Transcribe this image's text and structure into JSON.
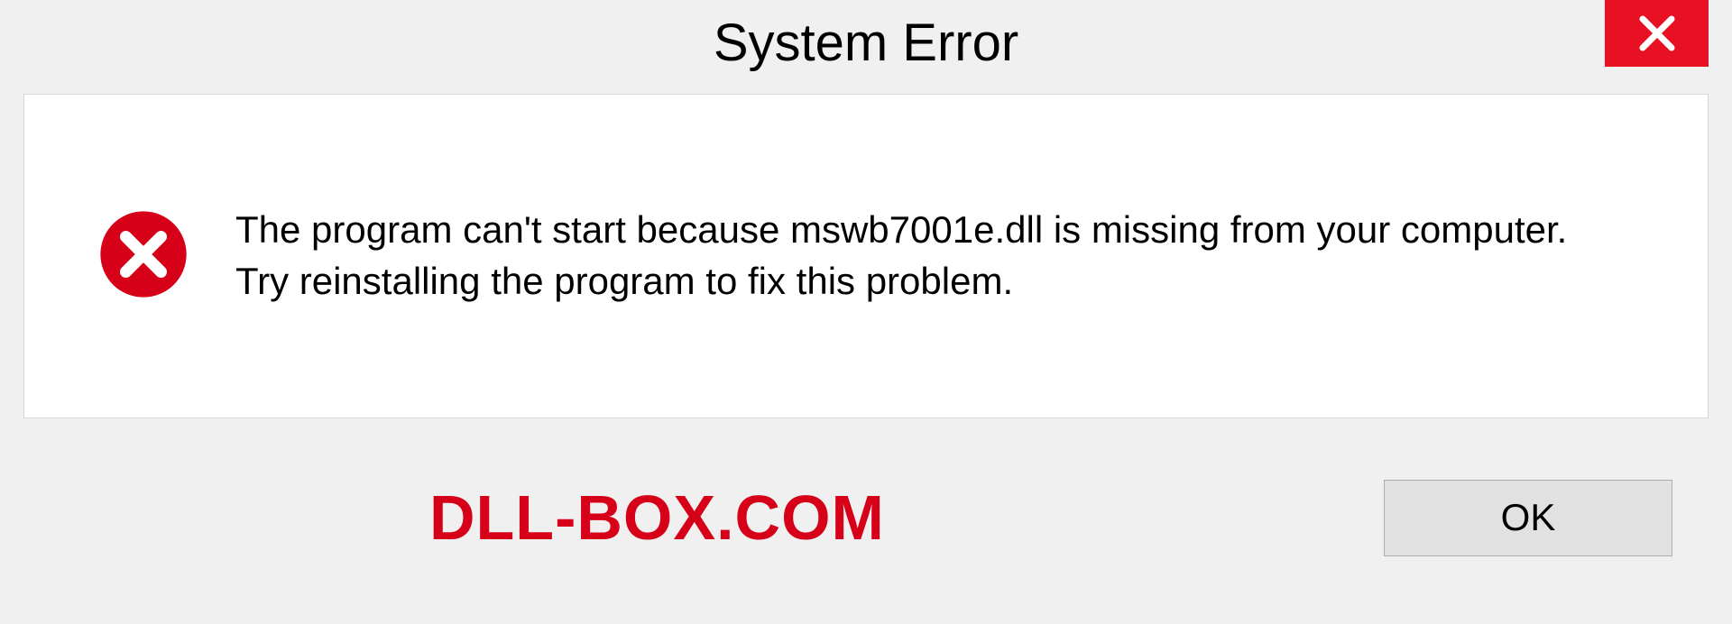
{
  "titlebar": {
    "title": "System Error"
  },
  "content": {
    "message": "The program can't start because mswb7001e.dll is missing from your computer. Try reinstalling the program to fix this problem."
  },
  "footer": {
    "watermark": "DLL-BOX.COM",
    "ok_label": "OK"
  },
  "colors": {
    "close_bg": "#e81123",
    "error_icon": "#d60018",
    "watermark": "#d60018"
  }
}
